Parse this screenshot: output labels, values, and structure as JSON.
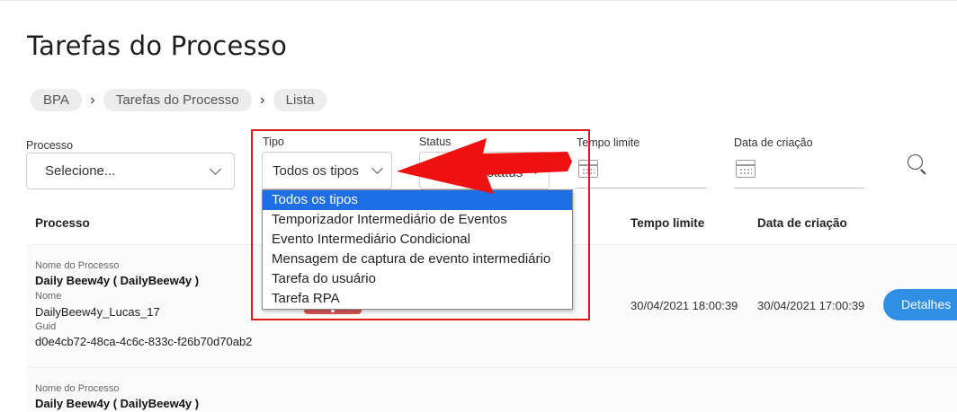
{
  "page": {
    "title": "Tarefas do Processo"
  },
  "breadcrumb": {
    "items": [
      "BPA",
      "Tarefas do Processo",
      "Lista"
    ]
  },
  "filters": {
    "processo": {
      "label": "Processo",
      "value": "Selecione..."
    },
    "tipo": {
      "label": "Tipo",
      "value": "Todos os tipos"
    },
    "status": {
      "label": "Status",
      "value": "Todos os status"
    },
    "tempo_limite": {
      "label": "Tempo limite",
      "value": ""
    },
    "data_criacao": {
      "label": "Data de criação",
      "value": ""
    }
  },
  "tipo_dropdown": {
    "options": [
      "Todos os tipos",
      "Temporizador Intermediário de Eventos",
      "Evento Intermediário Condicional",
      "Mensagem de captura de evento intermediário",
      "Tarefa do usuário",
      "Tarefa RPA"
    ],
    "selected_index": 0
  },
  "table": {
    "headers": {
      "processo": "Processo",
      "tempo_limite": "Tempo limite",
      "data_criacao": "Data de criação"
    },
    "rows": [
      {
        "nome_processo_label": "Nome do Processo",
        "nome_processo": "Daily Beew4y ( DailyBeew4y )",
        "nome_label": "Nome",
        "nome": "DailyBeew4y_Lucas_17",
        "guid_label": "Guid",
        "guid": "d0e4cb72-48ca-4c6c-833c-f26b70d70ab2",
        "tempo_limite": "30/04/2021 18:00:39",
        "data_criacao": "30/04/2021 17:00:39",
        "action": "Detalhes"
      },
      {
        "nome_processo_label": "Nome do Processo",
        "nome_processo": "Daily Beew4y ( DailyBeew4y )"
      }
    ]
  },
  "colors": {
    "accent": "#2f8fe5",
    "highlight": "#e01818",
    "selected_option": "#1e6fe6",
    "status_badge": "#d9534f"
  }
}
